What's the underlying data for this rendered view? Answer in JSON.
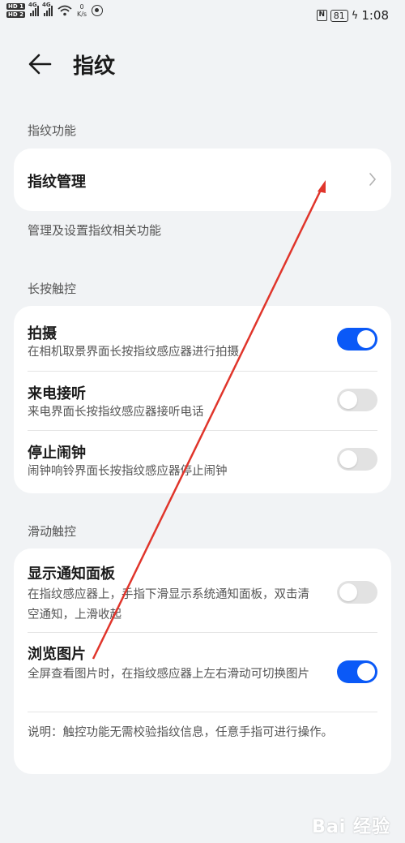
{
  "status_bar": {
    "hd1": "HD 1",
    "hd2": "HD 2",
    "net1": "4G",
    "net2": "4G",
    "speed_value": "0",
    "speed_unit": "K/s",
    "nfc": "N",
    "battery": "81",
    "time": "1:08"
  },
  "header": {
    "title": "指纹"
  },
  "sections": {
    "fingerprint_function": {
      "label": "指纹功能",
      "manage_title": "指纹管理",
      "description": "管理及设置指纹相关功能"
    },
    "long_press": {
      "label": "长按触控",
      "items": [
        {
          "title": "拍摄",
          "subtitle": "在相机取景界面长按指纹感应器进行拍摄",
          "enabled": true
        },
        {
          "title": "来电接听",
          "subtitle": "来电界面长按指纹感应器接听电话",
          "enabled": false
        },
        {
          "title": "停止闹钟",
          "subtitle": "闹钟响铃界面长按指纹感应器停止闹钟",
          "enabled": false
        }
      ]
    },
    "swipe": {
      "label": "滑动触控",
      "items": [
        {
          "title": "显示通知面板",
          "subtitle": "在指纹感应器上，手指下滑显示系统通知面板，双击清空通知，上滑收起",
          "enabled": false
        },
        {
          "title": "浏览图片",
          "subtitle": "全屏查看图片时，在指纹感应器上左右滑动可切换图片",
          "enabled": true
        }
      ],
      "note": "说明：触控功能无需校验指纹信息，任意手指可进行操作。"
    }
  },
  "watermark": "Bai 经验",
  "colors": {
    "accent": "#0a59f7",
    "annotation_arrow": "#e0352b"
  }
}
